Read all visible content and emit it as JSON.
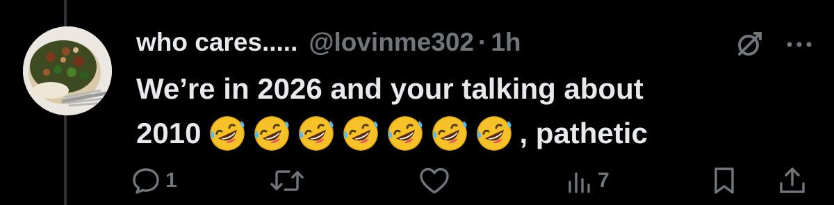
{
  "tweet": {
    "display_name": "who cares.....",
    "handle": "@lovinme302",
    "separator": "·",
    "time": "1h",
    "text_line1": "We’re in 2026 and your talking about",
    "text_line2_start": "2010",
    "text_line2_end": ", pathetic",
    "emoji": "rolling-on-the-floor-laughing",
    "emoji_count": 7
  },
  "icons": {
    "grok": "grok-icon",
    "more": "more-icon",
    "reply": "reply-icon",
    "retweet": "retweet-icon",
    "like": "heart-icon",
    "views": "views-icon",
    "bookmark": "bookmark-icon",
    "share": "share-icon"
  },
  "actions": {
    "reply_count": "1",
    "views_count": "7"
  },
  "colors": {
    "background": "#000000",
    "primary_text": "#e7e9ea",
    "secondary_text": "#71767b",
    "thread_line": "#2f3336"
  }
}
